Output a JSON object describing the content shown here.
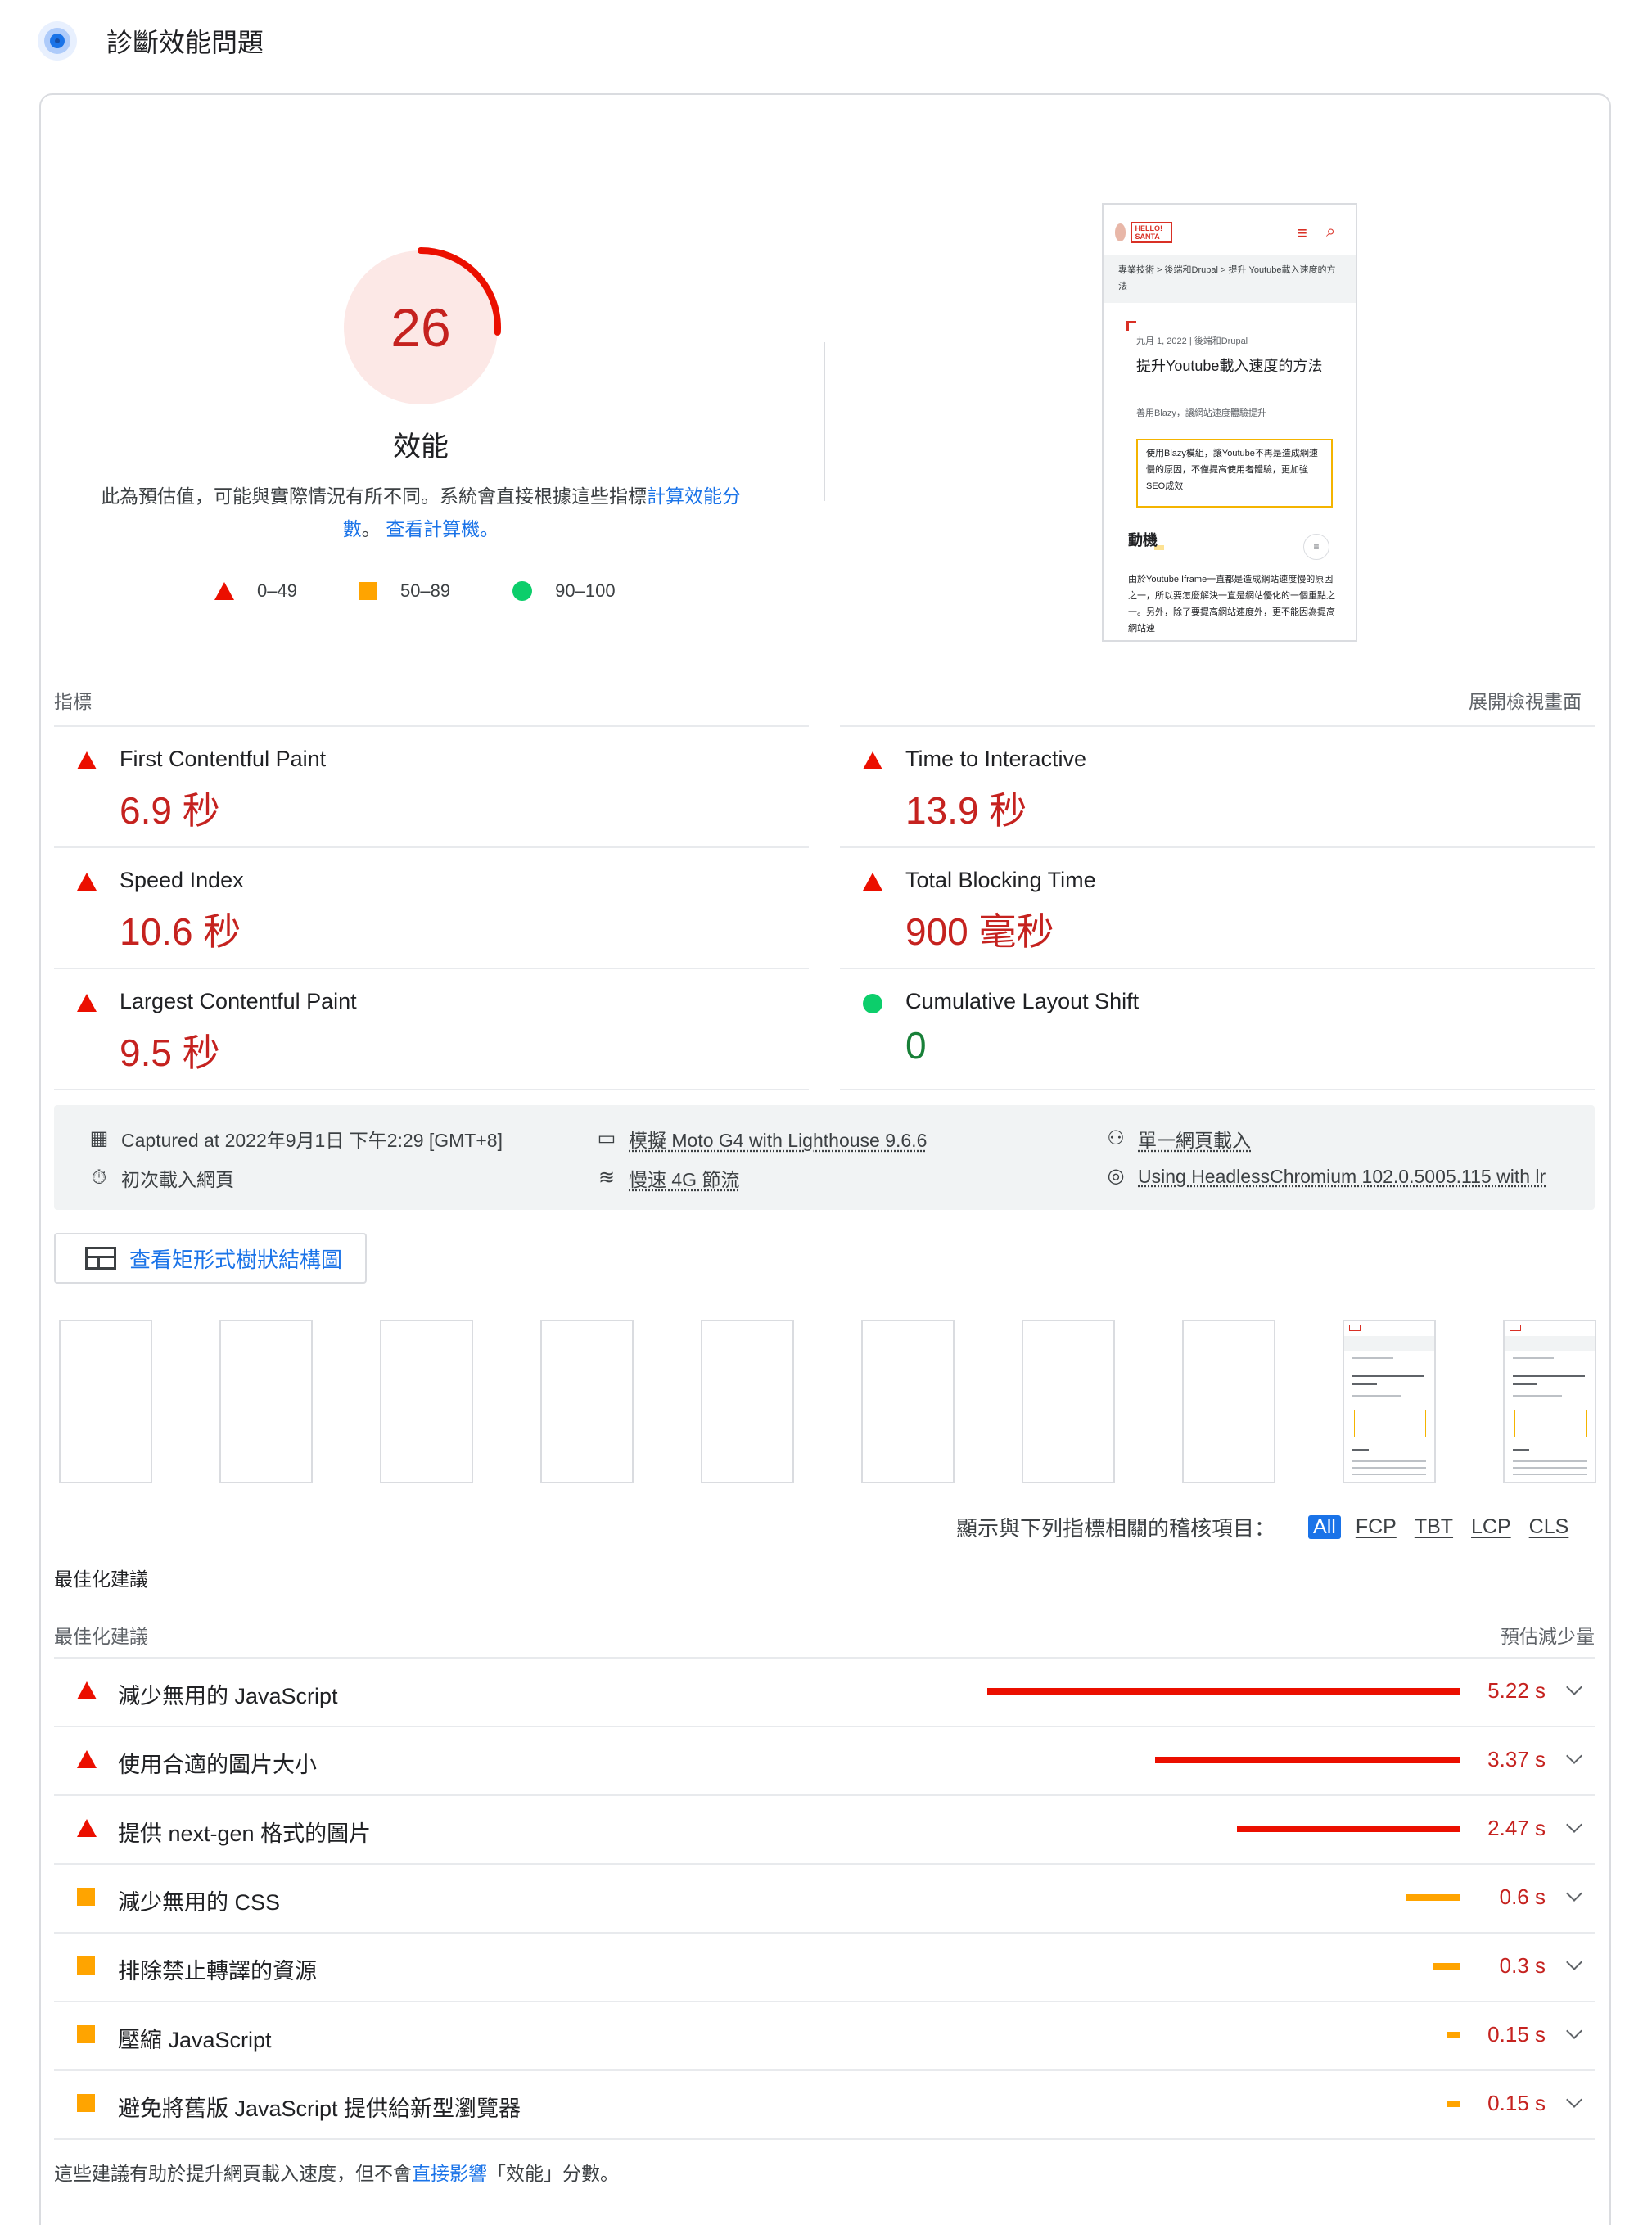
{
  "header": {
    "title": "診斷效能問題",
    "icon": "lighthouse-icon"
  },
  "gauge": {
    "score": "26",
    "score_value": 26,
    "title": "效能",
    "desc_prefix": "此為預估值，可能與實際情況有所不同。系統會直接根據這些指標",
    "desc_link1": "計算效能分數",
    "desc_sep": "。",
    "desc_link2": "查看計算機。"
  },
  "legend": {
    "fail": "0–49",
    "average": "50–89",
    "pass": "90–100"
  },
  "colors": {
    "fail": "#eb0f00",
    "fail_text": "#c5221f",
    "average": "#ffa400",
    "pass": "#0cce6b",
    "pass_text": "#188038",
    "link": "#1a73e8"
  },
  "screenshot": {
    "logo_text": "HELLO! SANTA",
    "breadcrumb": "專業技術 > 後端和Drupal > 提升 Youtube載入速度的方法",
    "date": "九月 1, 2022 | 後端和Drupal",
    "title": "提升Youtube載入速度的方法",
    "subtitle": "善用Blazy，讓網站速度體驗提升",
    "box_text": "使用Blazy模組，讓Youtube不再是造成網速慢的原因，不僅提高使用者體驗，更加強SEO成效",
    "heading": "動機",
    "body": "由於Youtube Iframe一直都是造成網站速度慢的原因之一，所以要怎麼解決一直是網站優化的一個重點之一。另外，除了要提高網站速度外，更不能因為提高網站速"
  },
  "metrics": {
    "section_label": "指標",
    "expand_label": "展開檢視畫面",
    "items": [
      {
        "name": "First Contentful Paint",
        "value": "6.9 秒",
        "status": "fail"
      },
      {
        "name": "Time to Interactive",
        "value": "13.9 秒",
        "status": "fail"
      },
      {
        "name": "Speed Index",
        "value": "10.6 秒",
        "status": "fail"
      },
      {
        "name": "Total Blocking Time",
        "value": "900 毫秒",
        "status": "fail"
      },
      {
        "name": "Largest Contentful Paint",
        "value": "9.5 秒",
        "status": "fail"
      },
      {
        "name": "Cumulative Layout Shift",
        "value": "0",
        "status": "pass"
      }
    ]
  },
  "environment": {
    "captured": "Captured at 2022年9月1日 下午2:29 [GMT+8]",
    "device": "模擬 Moto G4 with Lighthouse 9.6.6",
    "page_load": "單一網頁載入",
    "initial_load": "初次載入網頁",
    "throttling": "慢速 4G 節流",
    "browser": "Using HeadlessChromium 102.0.5005.115 with lr"
  },
  "treemap_button": "查看矩形式樹狀結構圖",
  "filter": {
    "label": "顯示與下列指標相關的稽核項目：",
    "chips": [
      "All",
      "FCP",
      "TBT",
      "LCP",
      "CLS"
    ]
  },
  "opportunities": {
    "section_title": "最佳化建議",
    "col_left": "最佳化建議",
    "col_right": "預估減少量",
    "max_seconds": 5.22,
    "items": [
      {
        "name": "減少無用的 JavaScript",
        "value": "5.22 s",
        "seconds": 5.22,
        "status": "fail"
      },
      {
        "name": "使用合適的圖片大小",
        "value": "3.37 s",
        "seconds": 3.37,
        "status": "fail"
      },
      {
        "name": "提供 next-gen 格式的圖片",
        "value": "2.47 s",
        "seconds": 2.47,
        "status": "fail"
      },
      {
        "name": "減少無用的 CSS",
        "value": "0.6 s",
        "seconds": 0.6,
        "status": "average"
      },
      {
        "name": "排除禁止轉譯的資源",
        "value": "0.3 s",
        "seconds": 0.3,
        "status": "average"
      },
      {
        "name": "壓縮 JavaScript",
        "value": "0.15 s",
        "seconds": 0.15,
        "status": "average"
      },
      {
        "name": "避免將舊版 JavaScript 提供給新型瀏覽器",
        "value": "0.15 s",
        "seconds": 0.15,
        "status": "average"
      }
    ]
  },
  "footnote": {
    "prefix": "這些建議有助於提升網頁載入速度，但不會",
    "link": "直接影響",
    "suffix": "「效能」分數。"
  }
}
